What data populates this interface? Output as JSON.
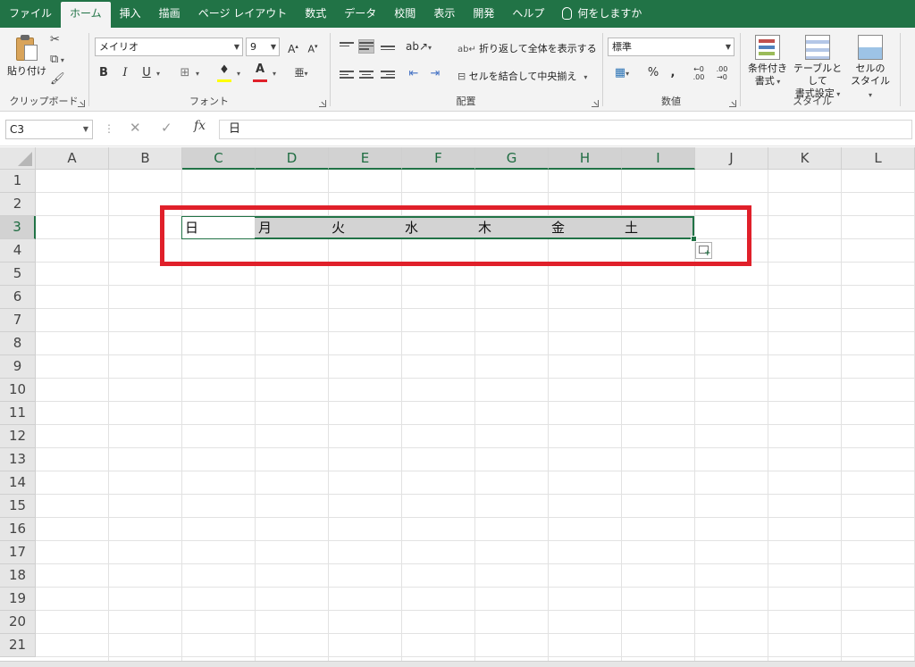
{
  "menu": {
    "tabs": [
      "ファイル",
      "ホーム",
      "挿入",
      "描画",
      "ページ レイアウト",
      "数式",
      "データ",
      "校閲",
      "表示",
      "開発",
      "ヘルプ"
    ],
    "active_tab": "ホーム",
    "tell_me": "何をしますか"
  },
  "ribbon": {
    "clipboard": {
      "paste_label": "貼り付け",
      "group_label": "クリップボード"
    },
    "font": {
      "font_name": "メイリオ",
      "font_size": "9",
      "group_label": "フォント"
    },
    "alignment": {
      "wrap_text": "折り返して全体を表示する",
      "merge_center": "セルを結合して中央揃え",
      "group_label": "配置"
    },
    "number": {
      "format": "標準",
      "group_label": "数値"
    },
    "styles": {
      "conditional_format": [
        "条件付き",
        "書式"
      ],
      "format_as_table": [
        "テーブルとして",
        "書式設定"
      ],
      "cell_styles": [
        "セルの",
        "スタイル"
      ],
      "group_label": "スタイル"
    }
  },
  "formula_bar": {
    "name_box": "C3",
    "content": "日"
  },
  "grid": {
    "columns": [
      "A",
      "B",
      "C",
      "D",
      "E",
      "F",
      "G",
      "H",
      "I",
      "J",
      "K",
      "L"
    ],
    "selected_columns": [
      "C",
      "D",
      "E",
      "F",
      "G",
      "H",
      "I"
    ],
    "rows": [
      "1",
      "2",
      "3",
      "4",
      "5",
      "6",
      "7",
      "8",
      "9",
      "10",
      "11",
      "12",
      "13",
      "14",
      "15",
      "16",
      "17",
      "18",
      "19",
      "20",
      "21"
    ],
    "selected_row": "3",
    "row3_values": [
      "日",
      "月",
      "火",
      "水",
      "木",
      "金",
      "土"
    ]
  },
  "colors": {
    "excel_green": "#217346",
    "highlight_red": "#e0202a",
    "selection_fill": "#d3d3d3"
  }
}
